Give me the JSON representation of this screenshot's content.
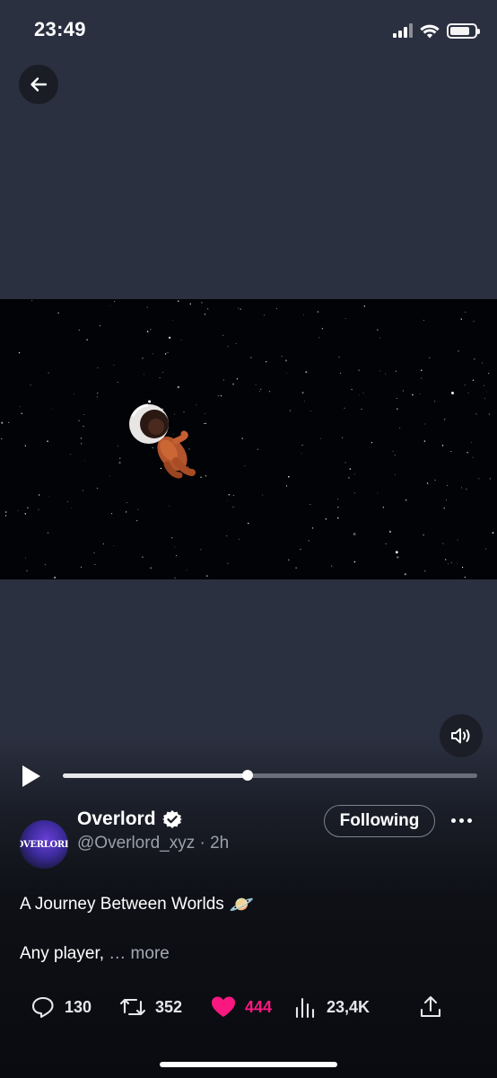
{
  "status_bar": {
    "time": "23:49",
    "icons": [
      "cellular-signal-icon",
      "wifi-icon",
      "battery-icon"
    ],
    "battery_level": 0.8
  },
  "navigation": {
    "back_icon": "arrow-left-icon"
  },
  "video": {
    "scene": "astronaut floating in starfield",
    "mute_icon": "speaker-icon",
    "play_icon": "play-icon",
    "progress": 0.445
  },
  "author": {
    "display_name": "Overlord",
    "handle": "@Overlord_xyz",
    "separator": "·",
    "time_ago": "2h",
    "avatar_text": "OVERLORD",
    "verified_icon": "verified-badge-icon",
    "follow_label": "Following",
    "more_icon": "more-dots-icon"
  },
  "tweet": {
    "line1": "A Journey Between Worlds",
    "line1_emoji": "🪐",
    "line2": "Any player,",
    "more_label": "… more"
  },
  "actions": {
    "replies": "130",
    "reposts": "352",
    "likes": "444",
    "views": "23,4K",
    "like_color": "#f91880",
    "icons": [
      "reply-icon",
      "repost-icon",
      "heart-icon",
      "views-icon",
      "share-icon"
    ]
  },
  "colors": {
    "background": "#2b3040",
    "video_bg": "#020306",
    "secondary_text": "#9aa0ab"
  }
}
